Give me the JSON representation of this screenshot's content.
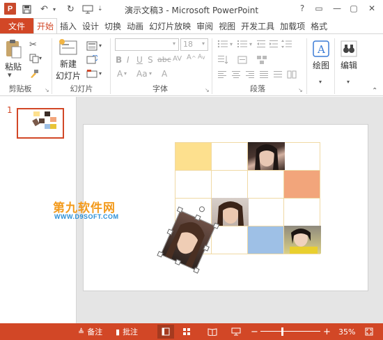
{
  "app": {
    "logo_letter": "P",
    "window_title": "演示文稿3 - Microsoft PowerPoint",
    "window_controls": [
      "?",
      "▭",
      "—",
      "▢",
      "✕"
    ]
  },
  "tabs": {
    "file": "文件",
    "items": [
      "开始",
      "插入",
      "设计",
      "切换",
      "动画",
      "幻灯片放映",
      "审阅",
      "视图",
      "开发工具",
      "加载项",
      "格式"
    ],
    "active_index": 0
  },
  "ribbon": {
    "clipboard": {
      "paste_label": "粘贴",
      "group_label": "剪贴板"
    },
    "slides": {
      "new_slide_label": "新建",
      "new_slide_label2": "幻灯片",
      "group_label": "幻灯片"
    },
    "font": {
      "size_value": "18",
      "group_label": "字体"
    },
    "paragraph": {
      "group_label": "段落"
    },
    "drawing": {
      "label": "绘图"
    },
    "editing": {
      "label": "编辑"
    }
  },
  "thumbnails": {
    "slide_number": "1"
  },
  "watermark": {
    "cn": "第九软件网",
    "en": "WWW.D9SOFT.COM"
  },
  "status": {
    "notes_label": "备注",
    "comments_label": "批注",
    "zoom_minus": "−",
    "zoom_plus": "+",
    "zoom_percent": "35%",
    "zoom_level": 0.35
  },
  "colors": {
    "accent": "#d24726",
    "cell_yellow": "#fde08e",
    "cell_orange": "#f2a57b",
    "cell_blue": "#9ec0e6",
    "grid_line": "#f0d9a4"
  }
}
